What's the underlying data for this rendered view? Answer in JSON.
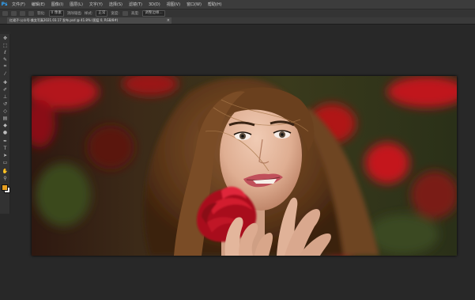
{
  "app": {
    "logo": "Ps",
    "logo_color": "#31a8ff"
  },
  "menu": [
    {
      "label": "文件(F)"
    },
    {
      "label": "编辑(E)"
    },
    {
      "label": "图像(I)"
    },
    {
      "label": "图层(L)"
    },
    {
      "label": "文字(Y)"
    },
    {
      "label": "选择(S)"
    },
    {
      "label": "滤镜(T)"
    },
    {
      "label": "3D(D)"
    },
    {
      "label": "视图(V)"
    },
    {
      "label": "窗口(W)"
    },
    {
      "label": "帮助(H)"
    }
  ],
  "options": {
    "feather_label": "羽化:",
    "feather_value": "0 像素",
    "antialias_label": "消除锯齿",
    "style_label": "样式:",
    "style_value": "正常",
    "width_label": "宽度:",
    "height_label": "高度:",
    "refine_edge": "调整边缘..."
  },
  "document_tab": {
    "title": "红裙子-公众号-美女写真2021.03.17 发布.psd @ 41.8% (图层 0, RGB/8#)",
    "close": "×"
  },
  "tools": [
    {
      "icon": "move-tool-icon",
      "glyph": "✥"
    },
    {
      "icon": "marquee-tool-icon",
      "glyph": "⬚"
    },
    {
      "icon": "lasso-tool-icon",
      "glyph": "ℓ"
    },
    {
      "icon": "quick-select-icon",
      "glyph": "✎"
    },
    {
      "icon": "crop-tool-icon",
      "glyph": "⌗"
    },
    {
      "icon": "eyedropper-icon",
      "glyph": "⁄"
    },
    {
      "icon": "healing-brush-icon",
      "glyph": "✚"
    },
    {
      "icon": "brush-tool-icon",
      "glyph": "✐"
    },
    {
      "icon": "clone-stamp-icon",
      "glyph": "⊥"
    },
    {
      "icon": "history-brush-icon",
      "glyph": "↺"
    },
    {
      "icon": "eraser-tool-icon",
      "glyph": "◇"
    },
    {
      "icon": "gradient-tool-icon",
      "glyph": "▤"
    },
    {
      "icon": "blur-tool-icon",
      "glyph": "◆"
    },
    {
      "icon": "dodge-tool-icon",
      "glyph": "●"
    },
    {
      "icon": "pen-tool-icon",
      "glyph": "✒"
    },
    {
      "icon": "type-tool-icon",
      "glyph": "T"
    },
    {
      "icon": "path-select-icon",
      "glyph": "➤"
    },
    {
      "icon": "shape-tool-icon",
      "glyph": "▭"
    },
    {
      "icon": "hand-tool-icon",
      "glyph": "✋"
    },
    {
      "icon": "zoom-tool-icon",
      "glyph": "⚲"
    }
  ],
  "colors": {
    "foreground": "#e8a020",
    "background": "#ffffff",
    "workspace": "#282828"
  }
}
